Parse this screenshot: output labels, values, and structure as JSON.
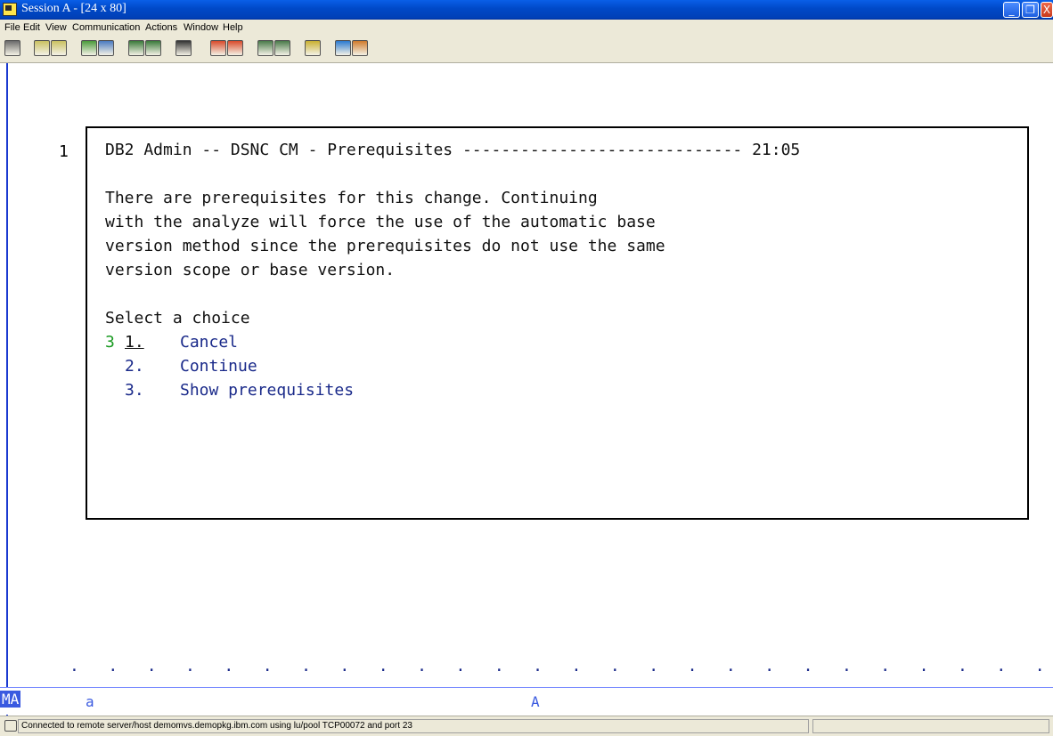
{
  "window": {
    "title": "Session A - [24 x 80]",
    "buttons": {
      "minimize": "_",
      "restore": "❐",
      "close": "X"
    }
  },
  "menubar": {
    "items": [
      {
        "label": "File"
      },
      {
        "label": "Edit"
      },
      {
        "label": "View"
      },
      {
        "label": "Communication"
      },
      {
        "label": "Actions"
      },
      {
        "label": "Window"
      },
      {
        "label": "Help"
      }
    ]
  },
  "toolbar": {
    "icons": [
      "print-screen-icon",
      "copy-icon",
      "paste-icon",
      "send-file-icon",
      "receive-file-icon",
      "display-icon",
      "keyboard-icon",
      "macro-icon",
      "record-macro-icon",
      "play-macro-icon",
      "connect-icon",
      "disconnect-icon",
      "clipboard-icon",
      "globe-icon",
      "edit-icon"
    ],
    "colors": [
      "#6a6a6a",
      "#c9c060",
      "#c9c060",
      "#4a9a3a",
      "#4a7ac0",
      "#3a7a3a",
      "#333333",
      "#555555",
      "#d84a2a",
      "#d84a2a",
      "#4a7a4a",
      "#4a7a4a",
      "#c9b030",
      "#2a7ad0",
      "#d07a2a"
    ]
  },
  "terminal": {
    "pane_number": "1",
    "header": "DB2 Admin -- DSNC CM - Prerequisites ----------------------------- 21:05",
    "message_lines": [
      "There are prerequisites for this change. Continuing",
      "with the analyze will force the use of the automatic base",
      "version method since the prerequisites do not use the same",
      "version scope or base version."
    ],
    "prompt": "Select a choice",
    "selected_value": "3",
    "choices": [
      {
        "number": "1.",
        "label": "Cancel"
      },
      {
        "number": "2.",
        "label": "Continue"
      },
      {
        "number": "3.",
        "label": "Show prerequisites"
      }
    ]
  },
  "oia": {
    "mode": "MA",
    "field_a": "a",
    "field_A": "A",
    "dots": ".   .   .   .   .   .   .   .   .   .   .   .   .   .   .   .   .   .   .   .   .   .   .   .   .   .   ."
  },
  "statusbar": {
    "text": "Connected to remote server/host demomvs.demopkg.ibm.com using lu/pool TCP00072 and port 23"
  }
}
